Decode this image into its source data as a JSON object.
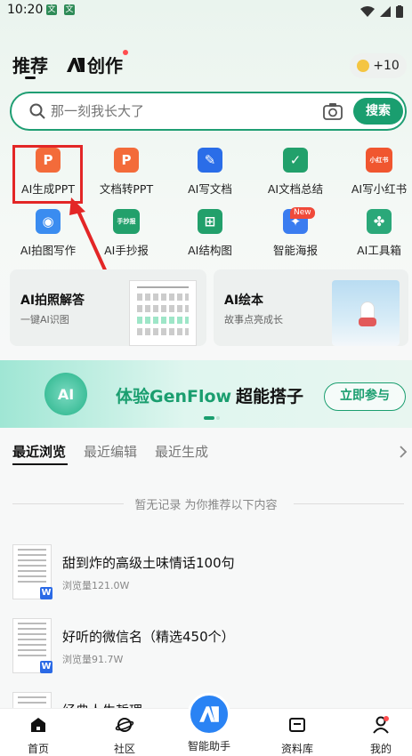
{
  "status": {
    "time": "10:20",
    "badge1": "文",
    "badge2": "文"
  },
  "header": {
    "tab_recommend": "推荐",
    "tab_create": "创作",
    "coins": "+10"
  },
  "search": {
    "placeholder": "那一刻我长大了",
    "button": "搜索"
  },
  "tools": [
    {
      "label": "AI生成PPT",
      "icon": "ppt-icon",
      "color": "#f36b3a",
      "glyph": "P"
    },
    {
      "label": "文档转PPT",
      "icon": "doc-to-ppt-icon",
      "color": "#f36b3a",
      "glyph": "P"
    },
    {
      "label": "AI写文档",
      "icon": "write-doc-icon",
      "color": "#2a6de8",
      "glyph": "✎"
    },
    {
      "label": "AI文档总结",
      "icon": "doc-summary-icon",
      "color": "#22a06b",
      "glyph": "✓"
    },
    {
      "label": "AI写小红书",
      "icon": "xiaohongshu-icon",
      "color": "#f0562f",
      "glyph": "小红书"
    },
    {
      "label": "AI拍图写作",
      "icon": "camera-write-icon",
      "color": "#3a8cf0",
      "glyph": "◉"
    },
    {
      "label": "AI手抄报",
      "icon": "handcopy-icon",
      "color": "#22a06b",
      "glyph": "手抄报"
    },
    {
      "label": "AI结构图",
      "icon": "structure-icon",
      "color": "#22a06b",
      "glyph": "⊞"
    },
    {
      "label": "智能海报",
      "icon": "poster-icon",
      "color": "#3a7cf0",
      "glyph": "✦"
    },
    {
      "label": "AI工具箱",
      "icon": "toolbox-icon",
      "color": "#2aa879",
      "glyph": "✤"
    }
  ],
  "new_badge": "New",
  "cards": [
    {
      "title": "AI拍照解答",
      "subtitle": "一键AI识图"
    },
    {
      "title": "AI绘本",
      "subtitle": "故事点亮成长"
    }
  ],
  "banner": {
    "title_a": "体验GenFlow",
    "title_b": "超能搭子",
    "button": "立即参与"
  },
  "recent_tabs": [
    "最近浏览",
    "最近编辑",
    "最近生成"
  ],
  "empty_text": "暂无记录 为你推荐以下内容",
  "docs": [
    {
      "title": "甜到炸的高级土味情话100句",
      "views": "浏览量121.0W"
    },
    {
      "title": "好听的微信名（精选450个）",
      "views": "浏览量91.7W"
    },
    {
      "title": "经典人生哲理",
      "views": ""
    }
  ],
  "bottom_nav": [
    {
      "label": "首页"
    },
    {
      "label": "社区"
    },
    {
      "label": "智能助手"
    },
    {
      "label": "资料库"
    },
    {
      "label": "我的"
    }
  ],
  "ai_logo": "AI",
  "colors": {
    "accent": "#1a9e6f",
    "highlight": "#e32626"
  }
}
